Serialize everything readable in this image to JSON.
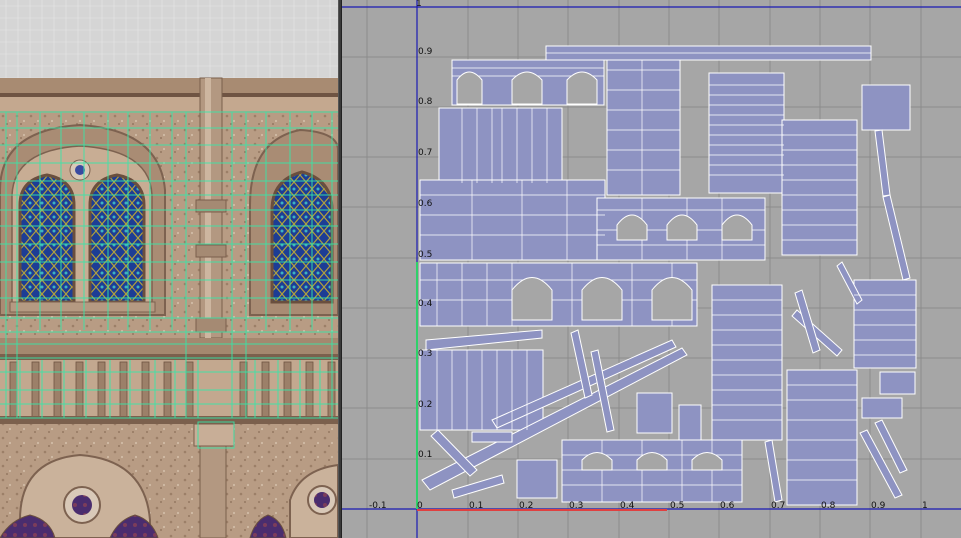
{
  "viewport": {
    "label": "3D viewport",
    "colors": {
      "stone": "#b99d84",
      "stone_dark": "#8c715c",
      "wire": "#35e8a6",
      "glass_blue": "#1f3f9a",
      "glass_yellow": "#b7a33a",
      "sky": "#d7d7d7"
    }
  },
  "uv_editor": {
    "label": "UV texture editor",
    "colors": {
      "background": "#a6a6a6",
      "grid": "#8d8d8d",
      "axis": "#1b1bb0",
      "shell_fill": "#8e93c2",
      "shell_stroke": "#ffffff",
      "u_axis_highlight": "#e04040",
      "v_axis_highlight": "#2fd16a"
    },
    "v_labels": [
      "1",
      "0.9",
      "0.8",
      "0.7",
      "0.6",
      "0.5",
      "0.4",
      "0.3",
      "0.2",
      "0.1"
    ],
    "u_labels": [
      "-0.1",
      "0",
      "0.1",
      "0.2",
      "0.3",
      "0.4",
      "0.5",
      "0.6",
      "0.7",
      "0.8",
      "0.9",
      "1"
    ]
  }
}
